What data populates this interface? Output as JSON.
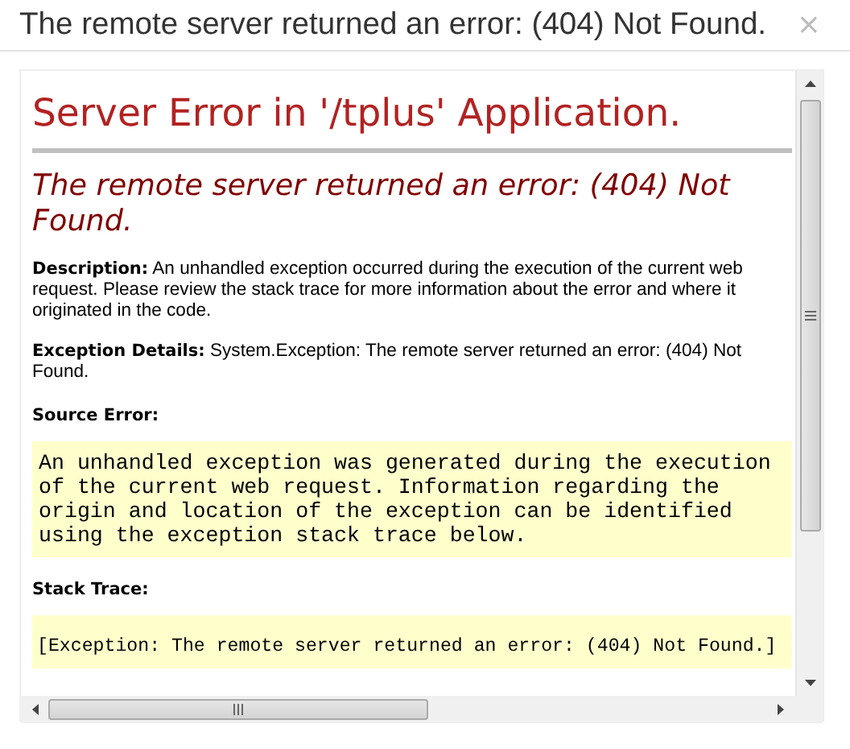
{
  "window": {
    "title": "The remote server returned an error: (404) Not Found.",
    "close": "×"
  },
  "page": {
    "heading": "Server Error in '/tplus' Application.",
    "error_message": "The remote server returned an error: (404) Not Found.",
    "description": "**Description:** An unhandled exception occurred during the execution of the current web request. Please review the stack trace for more information about the error and where it originated in the code.",
    "exception_details": "**Exception Details:** System.Exception: The remote server returned an error: (404) Not Found.",
    "source_error_label": "Source Error:",
    "source_error_lines": [
      "An unhandled exception was generated during the execution",
      "of the current web request. Information regarding the",
      "origin and location of the exception can be identified",
      "using the exception stack trace below."
    ],
    "stack_trace_label": "Stack Trace:",
    "stack_trace_lines": [
      "[Exception: The remote server returned an error: (404) Not Found.]"
    ]
  }
}
